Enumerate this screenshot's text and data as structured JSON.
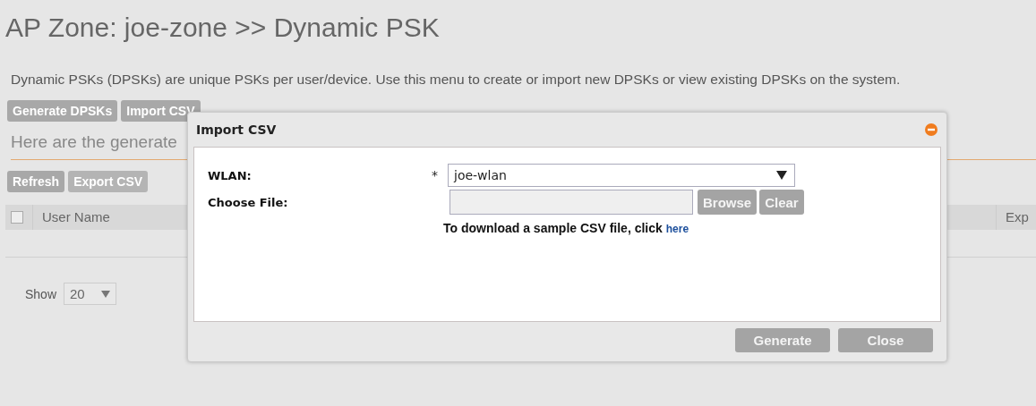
{
  "page": {
    "title": "AP Zone: joe-zone >> Dynamic PSK",
    "description": "Dynamic PSKs (DPSKs) are unique PSKs per user/device. Use this menu to create or import new DPSKs or view existing DPSKs on the system.",
    "actions": [
      "Generate DPSKs",
      "Import CSV"
    ],
    "subtitle": "Here are the generate",
    "toolbar": [
      "Refresh",
      "Export CSV"
    ],
    "table": {
      "select_all": {
        "checked": false
      },
      "columns": [
        "User Name",
        "Exp"
      ]
    },
    "pager": {
      "label": "Show",
      "page_size": "20"
    }
  },
  "dialog": {
    "title": "Import CSV",
    "wlan": {
      "label": "WLAN:",
      "required": "*",
      "value": "joe-wlan"
    },
    "file": {
      "label": "Choose File:",
      "browse": "Browse",
      "clear": "Clear"
    },
    "hint": {
      "text": "To download a sample CSV file, click",
      "link": "here"
    },
    "buttons": [
      "Generate",
      "Close"
    ]
  }
}
